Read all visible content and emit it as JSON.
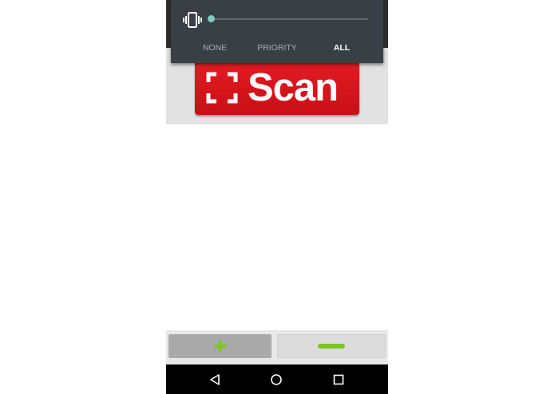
{
  "volume_panel": {
    "ringer_level": 0.0,
    "modes": [
      {
        "label": "NONE",
        "selected": false
      },
      {
        "label": "PRIORITY",
        "selected": false
      },
      {
        "label": "ALL",
        "selected": true
      }
    ],
    "accent_color": "#80cbc4"
  },
  "app": {
    "scan_button": {
      "label": "Scan",
      "color": "#e51b23"
    },
    "add_icon": "plus-icon",
    "remove_icon": "minus-icon",
    "indicator_color": "#7cc521"
  },
  "nav_bar": {
    "icons": [
      "back-icon",
      "home-icon",
      "recents-icon"
    ]
  }
}
